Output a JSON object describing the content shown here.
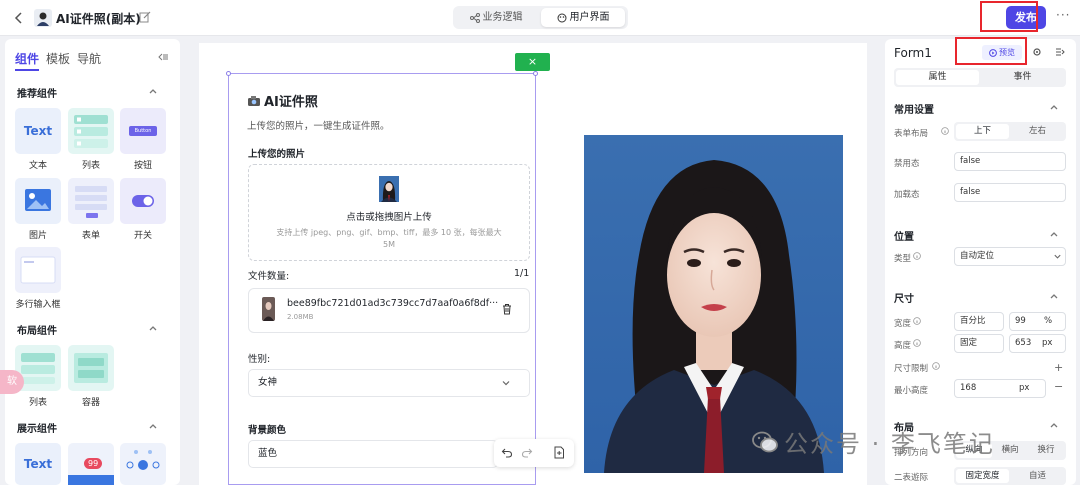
{
  "header": {
    "app_title": "AI证件照(副本)",
    "tabs": [
      {
        "label": "业务逻辑"
      },
      {
        "label": "用户界面",
        "active": true
      }
    ],
    "publish_label": "发布",
    "more_label": "···"
  },
  "left_panel": {
    "tabs": [
      "组件",
      "模板",
      "导航"
    ],
    "sections": [
      {
        "title": "推荐组件",
        "items": [
          "文本",
          "列表",
          "按钮",
          "图片",
          "表单",
          "开关",
          "多行输入框"
        ]
      },
      {
        "title": "布局组件",
        "items": [
          "列表",
          "容器"
        ]
      },
      {
        "title": "展示组件",
        "items": []
      }
    ],
    "thumb_text": "Text",
    "thumb_button": "Button",
    "thumb_badge": "99",
    "side_tag": "软"
  },
  "canvas": {
    "close_label": "×",
    "form_title": "AI证件照",
    "form_subtitle": "上传您的照片，一键生成证件照。",
    "upload_label": "上传您的照片",
    "upload_main": "点击或拖拽图片上传",
    "upload_hint": "支持上传 jpeg、png、gif、bmp、tiff，最多 10 张，每张最大 5M",
    "file_count_label": "文件数量:",
    "file_count_value": "1/1",
    "file_name": "bee89fbc721d01ad3c739cc7d7aaf0a6f8df···",
    "file_size": "2.08MB",
    "gender_label": "性别:",
    "gender_value": "女神",
    "bg_label": "背景颜色",
    "bg_value": "蓝色"
  },
  "right_panel": {
    "title": "Form1",
    "preview_label": "预览",
    "tabs": [
      "属性",
      "事件"
    ],
    "common_title": "常用设置",
    "layout_label": "表单布局",
    "layout_options": [
      "上下",
      "左右"
    ],
    "disabled_label": "禁用态",
    "disabled_value": "false",
    "loading_label": "加载态",
    "loading_value": "false",
    "position_title": "位置",
    "type_label": "类型",
    "type_value": "自动定位",
    "size_title": "尺寸",
    "width_label": "宽度",
    "width_mode": "百分比",
    "width_value": "99",
    "width_unit": "%",
    "height_label": "高度",
    "height_mode": "固定",
    "height_value": "653",
    "height_unit": "px",
    "size_limit_label": "尺寸限制",
    "min_height_label": "最小高度",
    "min_height_value": "168",
    "min_height_unit": "px",
    "layout_title": "布局",
    "arrange_label": "排列方向",
    "arrange_options": [
      "纵向",
      "横向",
      "换行"
    ],
    "second_row_label": "二表遊际",
    "second_row_options": [
      "固定宽度",
      "自适"
    ]
  },
  "watermark": "公众号 · 李飞笔记",
  "colors": {
    "accent": "#4e46e5",
    "highlight": "#e8262d",
    "green": "#21b14f",
    "photo_bg": "#3a6fb0"
  }
}
